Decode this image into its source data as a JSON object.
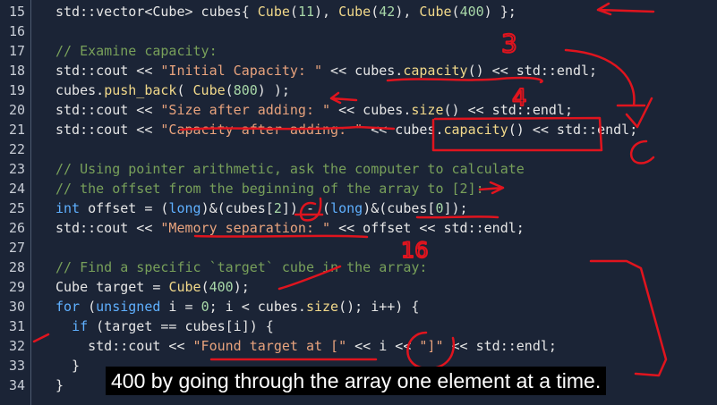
{
  "colors": {
    "background": "#1b2436",
    "text": "#e6e6e6",
    "keyword": "#5fb0ff",
    "function": "#f2d98a",
    "string": "#e8a37d",
    "number": "#a8d8a8",
    "comment": "#78a05a",
    "annotation": "#e0141e"
  },
  "code_lines": [
    {
      "n": "15",
      "tokens": [
        {
          "t": "std::vector<Cube> cubes{ "
        },
        {
          "t": "Cube",
          "c": "fn"
        },
        {
          "t": "("
        },
        {
          "t": "11",
          "c": "num"
        },
        {
          "t": "), "
        },
        {
          "t": "Cube",
          "c": "fn"
        },
        {
          "t": "("
        },
        {
          "t": "42",
          "c": "num"
        },
        {
          "t": "), "
        },
        {
          "t": "Cube",
          "c": "fn"
        },
        {
          "t": "("
        },
        {
          "t": "400",
          "c": "num"
        },
        {
          "t": ") };"
        }
      ]
    },
    {
      "n": "16",
      "tokens": []
    },
    {
      "n": "17",
      "tokens": [
        {
          "t": "// Examine capacity:",
          "c": "cm"
        }
      ]
    },
    {
      "n": "18",
      "tokens": [
        {
          "t": "std::cout << "
        },
        {
          "t": "\"Initial Capacity: \"",
          "c": "str"
        },
        {
          "t": " << cubes."
        },
        {
          "t": "capacity",
          "c": "fn"
        },
        {
          "t": "() << std::endl;"
        }
      ]
    },
    {
      "n": "19",
      "tokens": [
        {
          "t": "cubes."
        },
        {
          "t": "push_back",
          "c": "fn"
        },
        {
          "t": "( "
        },
        {
          "t": "Cube",
          "c": "fn"
        },
        {
          "t": "("
        },
        {
          "t": "800",
          "c": "num"
        },
        {
          "t": ") );"
        }
      ]
    },
    {
      "n": "20",
      "tokens": [
        {
          "t": "std::cout << "
        },
        {
          "t": "\"Size after adding: \"",
          "c": "str"
        },
        {
          "t": " << cubes."
        },
        {
          "t": "size",
          "c": "fn"
        },
        {
          "t": "() << std::endl;"
        }
      ]
    },
    {
      "n": "21",
      "tokens": [
        {
          "t": "std::cout << "
        },
        {
          "t": "\"Capacity after adding: \"",
          "c": "str"
        },
        {
          "t": " << cubes."
        },
        {
          "t": "capacity",
          "c": "fn"
        },
        {
          "t": "() << std::endl;"
        }
      ]
    },
    {
      "n": "22",
      "tokens": []
    },
    {
      "n": "23",
      "tokens": [
        {
          "t": "// Using pointer arithmetic, ask the computer to calculate",
          "c": "cm"
        }
      ]
    },
    {
      "n": "24",
      "tokens": [
        {
          "t": "// the offset from the beginning of the array to [2]:",
          "c": "cm"
        }
      ]
    },
    {
      "n": "25",
      "tokens": [
        {
          "t": "int",
          "c": "kw"
        },
        {
          "t": " offset = ("
        },
        {
          "t": "long",
          "c": "kw"
        },
        {
          "t": ")&(cubes["
        },
        {
          "t": "2",
          "c": "num"
        },
        {
          "t": "]) - ("
        },
        {
          "t": "long",
          "c": "kw"
        },
        {
          "t": ")&(cubes["
        },
        {
          "t": "0",
          "c": "num"
        },
        {
          "t": "]);"
        }
      ]
    },
    {
      "n": "26",
      "tokens": [
        {
          "t": "std::cout << "
        },
        {
          "t": "\"Memory separation: \"",
          "c": "str"
        },
        {
          "t": " << offset << std::endl;"
        }
      ]
    },
    {
      "n": "27",
      "tokens": []
    },
    {
      "n": "28",
      "tokens": [
        {
          "t": "// Find a specific `target` cube in the array:",
          "c": "cm"
        }
      ]
    },
    {
      "n": "29",
      "tokens": [
        {
          "t": "Cube target = "
        },
        {
          "t": "Cube",
          "c": "fn"
        },
        {
          "t": "("
        },
        {
          "t": "400",
          "c": "num"
        },
        {
          "t": ");"
        }
      ]
    },
    {
      "n": "30",
      "tokens": [
        {
          "t": "for",
          "c": "kw"
        },
        {
          "t": " ("
        },
        {
          "t": "unsigned",
          "c": "kw"
        },
        {
          "t": " i = "
        },
        {
          "t": "0",
          "c": "num"
        },
        {
          "t": "; i < cubes."
        },
        {
          "t": "size",
          "c": "fn"
        },
        {
          "t": "(); i++) {"
        }
      ]
    },
    {
      "n": "31",
      "tokens": [
        {
          "t": "  "
        },
        {
          "t": "if",
          "c": "kw"
        },
        {
          "t": " (target == cubes[i]) {"
        }
      ]
    },
    {
      "n": "32",
      "tokens": [
        {
          "t": "    std::cout << "
        },
        {
          "t": "\"Found target at [\"",
          "c": "str"
        },
        {
          "t": " << i << "
        },
        {
          "t": "\"]\"",
          "c": "str"
        },
        {
          "t": " << std::endl;"
        }
      ]
    },
    {
      "n": "33",
      "tokens": [
        {
          "t": "  }"
        }
      ]
    },
    {
      "n": "34",
      "tokens": [
        {
          "t": "}"
        }
      ]
    }
  ],
  "annotations": {
    "labels": [
      "3",
      "4",
      "16"
    ]
  },
  "caption": "400 by going through the array one element at a time."
}
